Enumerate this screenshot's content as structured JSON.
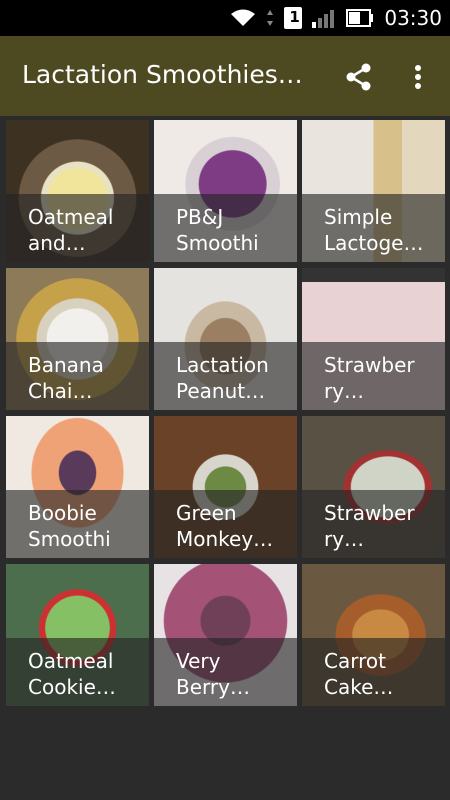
{
  "status_bar": {
    "time": "03:30",
    "sim_label": "1",
    "icons": [
      "wifi-icon",
      "sim-icon",
      "signal-icon",
      "battery-icon"
    ]
  },
  "toolbar": {
    "title": "Lactation Smoothies…",
    "share_icon": "share-icon",
    "more_icon": "more-vert-icon"
  },
  "recipes": [
    {
      "title": "Oatmeal\nand…"
    },
    {
      "title": "PB&J\nSmoothi"
    },
    {
      "title": "Simple\nLactoge…"
    },
    {
      "title": "Banana\nChai…"
    },
    {
      "title": "Lactation\nPeanut…"
    },
    {
      "title": "Strawber\nry…"
    },
    {
      "title": "Boobie\nSmoothi"
    },
    {
      "title": "Green\nMonkey…"
    },
    {
      "title": "Strawber\nry…"
    },
    {
      "title": "Oatmeal\nCookie…"
    },
    {
      "title": "Very\nBerry…"
    },
    {
      "title": "Carrot\nCake…"
    }
  ],
  "colors": {
    "toolbar": "#4d4a22",
    "background": "#2b2b2b",
    "status_bar": "#000000"
  }
}
